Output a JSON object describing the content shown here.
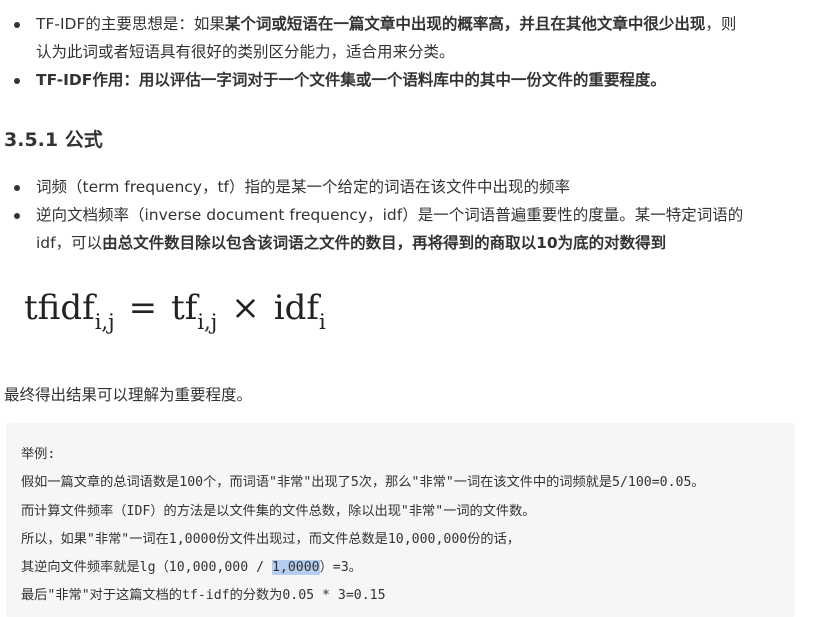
{
  "intro_bullets": [
    {
      "a": "TF-IDF的主要思想是：如果",
      "b": "某个词或短语在一篇文章中出现的概率高，并且在其他文章中很少出现",
      "c": "，则",
      "line2": "认为此词或者短语具有很好的类别区分能力，适合用来分类。"
    },
    {
      "label": "TF-IDF作用：用以评估一字词对于一个文件集或一个语料库中的其中一份文件的重要程度。"
    }
  ],
  "section_heading": "3.5.1 公式",
  "formula_bullets": [
    {
      "text": "词频（term frequency，tf）指的是某一个给定的词语在该文件中出现的频率"
    },
    {
      "line1": "逆向文档频率（inverse document frequency，idf）是一个词语普遍重要性的度量。某一特定词语的",
      "line2_a": "idf，可以",
      "line2_b": "由总文件数目除以包含该词语之文件的数目，再将得到的商取以10为底的对数得到"
    }
  ],
  "formula": {
    "lhs": "tfidf",
    "lhs_sub": "i,j",
    "eq": "=",
    "tf": "tf",
    "tf_sub": "i,j",
    "times": "×",
    "idf": "idf",
    "idf_sub": "i"
  },
  "paragraph": "最终得出结果可以理解为重要程度。",
  "example": {
    "title": "举例:",
    "line1": "假如一篇文章的总词语数是100个，而词语\"非常\"出现了5次，那么\"非常\"一词在该文件中的词频就是5/100=0.05。",
    "line2": "而计算文件频率（IDF）的方法是以文件集的文件总数，除以出现\"非常\"一词的文件数。",
    "line3": "所以，如果\"非常\"一词在1,0000份文件出现过，而文件总数是10,000,000份的话，",
    "line4_a": "其逆向文件频率就是lg（10,000,000 / ",
    "line4_sel": "1,0000",
    "line4_b": "）=3。",
    "line5": "最后\"非常\"对于这篇文档的tf-idf的分数为0.05 * 3=0.15"
  }
}
